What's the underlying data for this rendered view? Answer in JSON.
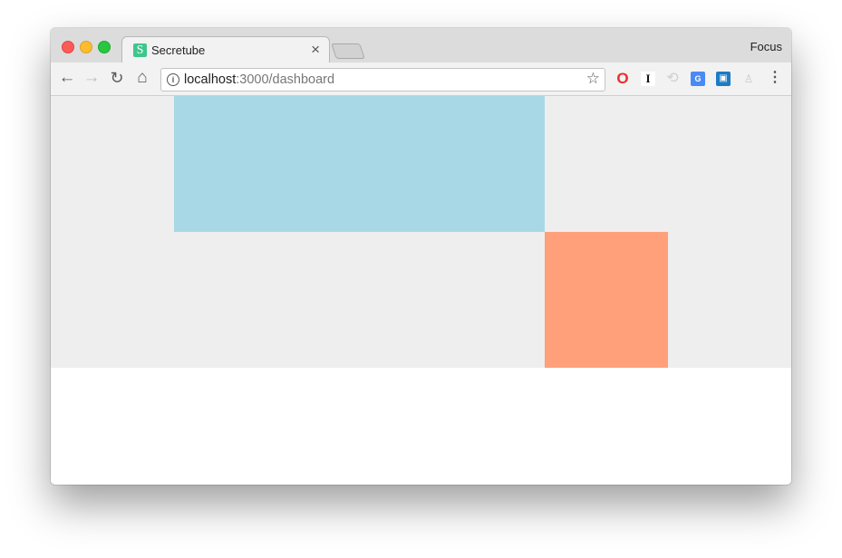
{
  "browser": {
    "tab": {
      "favicon_letter": "S",
      "title": "Secretube",
      "close_glyph": "×"
    },
    "profile_label": "Focus",
    "toolbar": {
      "back_glyph": "←",
      "forward_glyph": "→",
      "reload_glyph": "↻",
      "home_glyph": "⌂",
      "address": {
        "host": "localhost",
        "path": ":3000/dashboard"
      },
      "bookmark_glyph": "☆",
      "menu_glyph": "⋮"
    },
    "extensions": [
      {
        "name": "opera-icon",
        "glyph": "O"
      },
      {
        "name": "instapaper-icon",
        "glyph": "I"
      },
      {
        "name": "sync-icon",
        "glyph": "⟲"
      },
      {
        "name": "translate-icon",
        "glyph": "G"
      },
      {
        "name": "chat-icon",
        "glyph": "▣"
      },
      {
        "name": "tree-icon",
        "glyph": "♙"
      }
    ],
    "colors": {
      "tab_favicon": "#3ec68d",
      "content_background": "#eeeeee",
      "blue_block": "#a8d8e6",
      "orange_block": "#ffa07b"
    }
  }
}
